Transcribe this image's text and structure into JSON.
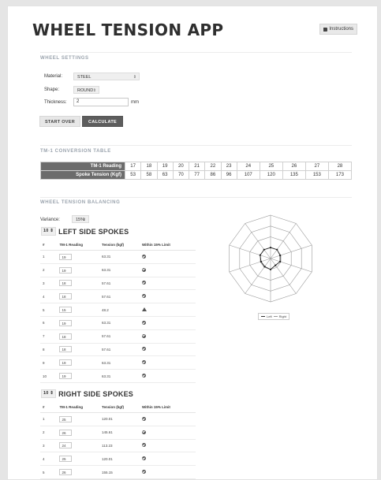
{
  "app": {
    "title": "WHEEL TENSION APP",
    "instructions_label": "Instructions"
  },
  "wheel_settings": {
    "heading": "WHEEL SETTINGS",
    "material_label": "Material:",
    "material_value": "STEEL",
    "shape_label": "Shape:",
    "shape_value": "ROUND",
    "thickness_label": "Thickness:",
    "thickness_value": "2",
    "thickness_unit": "mm",
    "start_over_label": "START OVER",
    "calculate_label": "CALCULATE"
  },
  "conversion": {
    "heading": "TM-1 CONVERSION TABLE",
    "reading_label": "TM-1 Reading",
    "tension_label": "Spoke Tension (Kgf)",
    "readings": [
      "17",
      "18",
      "19",
      "20",
      "21",
      "22",
      "23",
      "24",
      "25",
      "26",
      "27",
      "28"
    ],
    "tensions": [
      "53",
      "58",
      "63",
      "70",
      "77",
      "86",
      "96",
      "107",
      "120",
      "135",
      "153",
      "173"
    ]
  },
  "balancing": {
    "heading": "WHEEL TENSION BALANCING",
    "variance_label": "Variance:",
    "variance_value": "15%",
    "columns": [
      "#",
      "TM-1 Reading",
      "Tension (kgf)",
      "Within 15% Limit"
    ],
    "left": {
      "count": "10",
      "title": "LEFT SIDE SPOKES",
      "rows": [
        {
          "n": "1",
          "reading": "19",
          "tension": "63.31",
          "status": "ok"
        },
        {
          "n": "2",
          "reading": "19",
          "tension": "63.31",
          "status": "ok"
        },
        {
          "n": "3",
          "reading": "18",
          "tension": "57.61",
          "status": "ok"
        },
        {
          "n": "4",
          "reading": "18",
          "tension": "57.61",
          "status": "ok"
        },
        {
          "n": "5",
          "reading": "15",
          "tension": "48.2",
          "status": "warn"
        },
        {
          "n": "6",
          "reading": "19",
          "tension": "63.31",
          "status": "ok"
        },
        {
          "n": "7",
          "reading": "18",
          "tension": "57.61",
          "status": "ok"
        },
        {
          "n": "8",
          "reading": "18",
          "tension": "57.61",
          "status": "ok"
        },
        {
          "n": "9",
          "reading": "19",
          "tension": "63.31",
          "status": "ok"
        },
        {
          "n": "10",
          "reading": "19",
          "tension": "63.31",
          "status": "ok"
        }
      ]
    },
    "right": {
      "count": "10",
      "title": "RIGHT SIDE SPOKES",
      "rows": [
        {
          "n": "1",
          "reading": "25",
          "tension": "120.01",
          "status": "ok"
        },
        {
          "n": "2",
          "reading": "26",
          "tension": "145.61",
          "status": "ok"
        },
        {
          "n": "3",
          "reading": "24",
          "tension": "113.23",
          "status": "ok"
        },
        {
          "n": "4",
          "reading": "25",
          "tension": "120.01",
          "status": "ok"
        },
        {
          "n": "5",
          "reading": "26",
          "tension": "155.15",
          "status": "ok"
        }
      ]
    },
    "legend": {
      "left_label": "Left",
      "right_label": "Right"
    }
  },
  "chart_data": {
    "type": "radar",
    "axes": [
      "1",
      "2",
      "3",
      "4",
      "5",
      "6",
      "7",
      "8",
      "9",
      "10"
    ],
    "series": [
      {
        "name": "Left",
        "values": [
          63.31,
          63.31,
          57.61,
          57.61,
          48.2,
          63.31,
          57.61,
          57.61,
          63.31,
          63.31
        ]
      }
    ],
    "rings": 4,
    "legend": "bottom-right"
  },
  "colors": {
    "table_header_bg": "#6c6c6c",
    "calculate_bg": "#5d5d5d",
    "section_heading": "#9aa3ad"
  }
}
